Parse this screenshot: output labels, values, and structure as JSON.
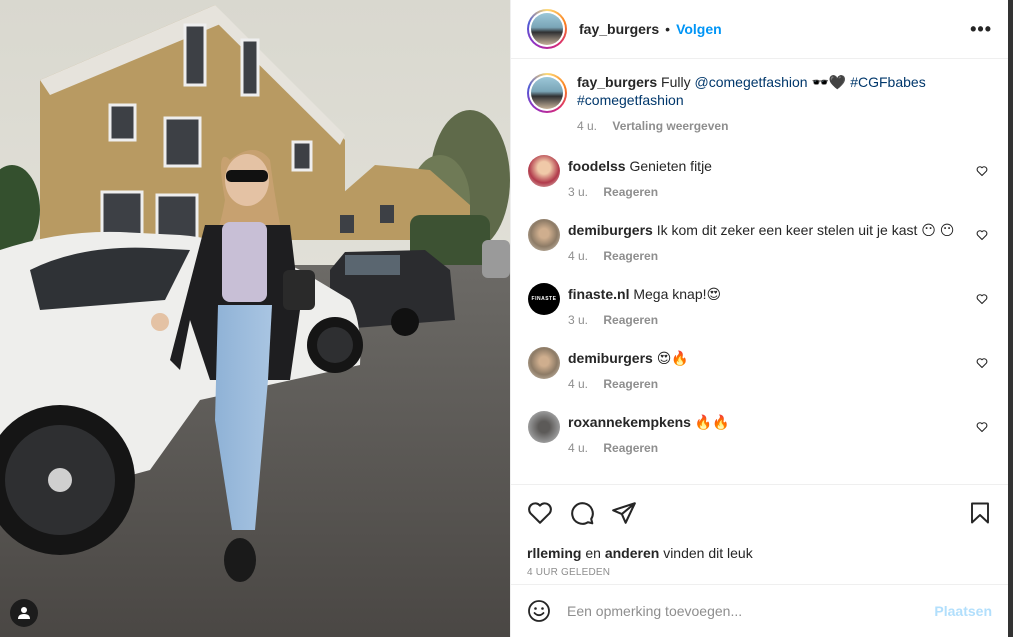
{
  "post": {
    "username": "fay_burgers",
    "separator": "•",
    "follow_label": "Volgen",
    "more_label": "•••",
    "caption": {
      "username": "fay_burgers",
      "text": "Fully",
      "mention": "@comegetfashion",
      "emoji": "🕶️🖤",
      "hashtag1": "#CGFbabes",
      "hashtag2": "#comegetfashion",
      "time": "4 u.",
      "translate_label": "Vertaling weergeven"
    },
    "comments": [
      {
        "username": "foodelss",
        "text": "Genieten fitje",
        "time": "3 u.",
        "reply": "Reageren"
      },
      {
        "username": "demiburgers",
        "text": "Ik kom dit zeker een keer stelen uit je kast 😶 😶",
        "time": "4 u.",
        "reply": "Reageren"
      },
      {
        "username": "finaste.nl",
        "avatar_text": "FINASTE",
        "text": "Mega knap!😍",
        "time": "3 u.",
        "reply": "Reageren"
      },
      {
        "username": "demiburgers",
        "text": "😍🔥",
        "time": "4 u.",
        "reply": "Reageren"
      },
      {
        "username": "roxannekempkens",
        "text": "🔥🔥",
        "time": "4 u.",
        "reply": "Reageren"
      }
    ],
    "likes": {
      "user": "rlleming",
      "connector": "en",
      "others": "anderen",
      "suffix": "vinden dit leuk"
    },
    "timestamp": "4 UUR GELEDEN",
    "add_comment": {
      "placeholder": "Een opmerking toevoegen...",
      "post_label": "Plaatsen"
    }
  },
  "colors": {
    "link_blue": "#0095f6",
    "mention": "#00376b",
    "muted": "#8e8e8e",
    "disabled_post": "#b2dffc"
  },
  "icons": [
    "user-tag-icon",
    "heart-icon",
    "comment-icon",
    "share-icon",
    "bookmark-icon",
    "emoji-icon",
    "more-icon"
  ]
}
